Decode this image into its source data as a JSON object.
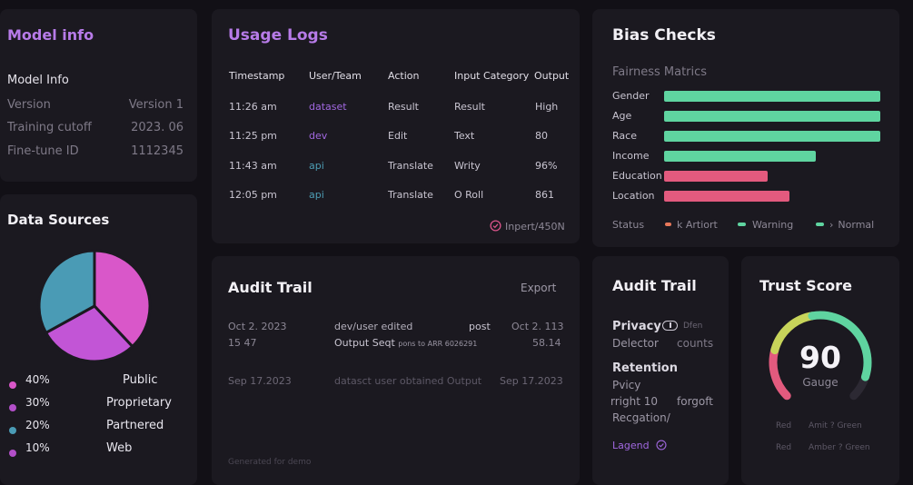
{
  "model_info": {
    "title": "Model info",
    "subtitle": "Model Info",
    "rows": [
      {
        "label": "Version",
        "value": "Version  1"
      },
      {
        "label": "Training cutoff",
        "value": "2023. 06"
      },
      {
        "label": "Fine-tune ID",
        "value": "1112345"
      }
    ]
  },
  "data_sources": {
    "title": "Data Sources",
    "items": [
      {
        "pct": "40%",
        "label": "Public",
        "color": "#d957c9"
      },
      {
        "pct": "30%",
        "label": "Proprietary",
        "color": "#b34fc9"
      },
      {
        "pct": "20%",
        "label": "Partnered",
        "color": "#4a9bb5"
      },
      {
        "pct": "10%",
        "label": "Web",
        "color": "#b34fc9"
      }
    ]
  },
  "chart_data": {
    "type": "pie",
    "categories": [
      "Public",
      "Proprietary",
      "Partnered"
    ],
    "values": [
      38,
      29,
      33
    ],
    "colors": [
      "#d957c9",
      "#c255d6",
      "#4a9bb5"
    ]
  },
  "usage_logs": {
    "title": "Usage Logs",
    "headers": [
      "Timestamp",
      "User/Team",
      "Action",
      "Input Category",
      "Output"
    ],
    "rows": [
      {
        "time": "11:26 am",
        "user": "dataset",
        "user_color": "purple",
        "action": "Result",
        "category": "Result",
        "output": "High"
      },
      {
        "time": "11:25 pm",
        "user": "dev",
        "user_color": "purple",
        "action": "Edit",
        "category": "Text",
        "output": "80"
      },
      {
        "time": "11:43 am",
        "user": "api",
        "user_color": "teal",
        "action": "Translate",
        "category": "Writy",
        "output": "96%"
      },
      {
        "time": "12:05 pm",
        "user": "api",
        "user_color": "teal",
        "action": "Translate",
        "category": "O Roll",
        "output": "861"
      }
    ],
    "footer": "Inpert/450N"
  },
  "bias_checks": {
    "title": "Bias Checks",
    "subtitle": "Fairness Matrics",
    "metrics": [
      {
        "label": "Gender",
        "fraction": 1.0,
        "color": "#5fd4a0"
      },
      {
        "label": "Age",
        "fraction": 1.0,
        "color": "#5fd4a0"
      },
      {
        "label": "Race",
        "fraction": 1.0,
        "color": "#5fd4a0"
      },
      {
        "label": "Income",
        "fraction": 0.7,
        "color": "#5fd4a0"
      },
      {
        "label": "Education",
        "fraction": 0.48,
        "color": "#e35a7e"
      },
      {
        "label": "Location",
        "fraction": 0.58,
        "color": "#e35a7e"
      }
    ],
    "status_label": "Status",
    "legend": [
      {
        "label": "k Artiort",
        "color": "#e8785a"
      },
      {
        "label": "Warning",
        "color": "#5fd4a0"
      },
      {
        "label": "Normal",
        "color": "#5fd4a0"
      }
    ]
  },
  "audit_trail_main": {
    "title": "Audit Trail",
    "export": "Export",
    "entries": [
      {
        "date": "Oct 2. 2023",
        "time": "15 47",
        "line1": "dev/user edited",
        "tag": "post",
        "line2": "Output Seqt",
        "line2_small": "pons to ARR 6026291",
        "right_date": "Oct 2. 113",
        "right_time": "58.14"
      },
      {
        "date": "Sep 17.2023",
        "line1": "datasct user obtained Output",
        "right_date": "Sep 17.2023"
      }
    ],
    "footer": "Generated for demo"
  },
  "audit_trail_side": {
    "title": "Audit Trail",
    "privacy": "Privacy",
    "privacy_tag": "Dfen",
    "detector": "Delector",
    "counts": "counts",
    "retention": "Retention",
    "pvicy": "Pvicy",
    "right10": "rright 10",
    "forgoft": "forgoft",
    "recgation": "Recgation/",
    "legend": "Lagend"
  },
  "trust_score": {
    "title": "Trust Score",
    "score": "90",
    "score_value": 90,
    "caption": "Gauge",
    "legend_rows": [
      {
        "left": "Red",
        "right": "Amit ? Green"
      },
      {
        "left": "Red",
        "right": "Amber ? Green"
      }
    ]
  }
}
